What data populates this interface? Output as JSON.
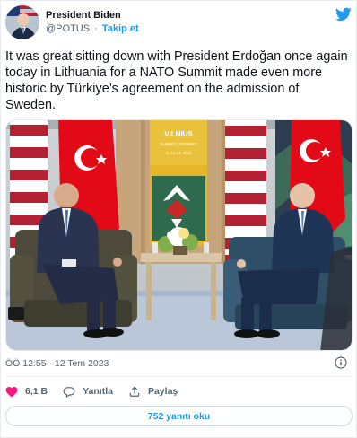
{
  "author": {
    "display_name": "President Biden",
    "handle": "@POTUS",
    "separator": "·",
    "follow_label": "Takip et"
  },
  "tweet": {
    "text": "It was great sitting down with President Erdoğan once again today in Lithuania for a NATO Summit made even more historic by Türkiye’s agreement on the admission of Sweden."
  },
  "photo": {
    "banner_title": "VILNIUS",
    "banner_subtitle": "SUMMIT | SOMMET",
    "banner_date": "11-12 VII 2023"
  },
  "meta": {
    "timestamp": "ÖÖ 12:55 · 12 Tem 2023"
  },
  "actions": {
    "like_count": "6,1 B",
    "reply_label": "Yanıtla",
    "share_label": "Paylaş"
  },
  "replies_button": {
    "label": "752 yanıtı oku"
  },
  "colors": {
    "accent": "#1d9bf0",
    "like": "#f91880",
    "text": "#0f1419",
    "muted": "#536471"
  },
  "icons": [
    "twitter-bird-icon",
    "info-icon",
    "heart-icon",
    "reply-icon",
    "share-icon"
  ]
}
